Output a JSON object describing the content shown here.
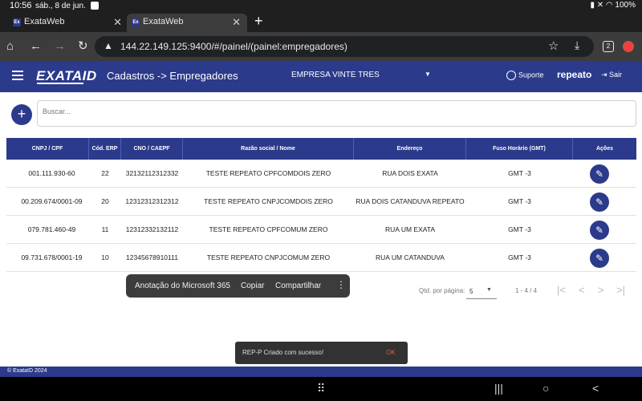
{
  "status_bar": {
    "time": "10:56",
    "date": "sáb., 8 de jun.",
    "battery": "100%"
  },
  "browser": {
    "tabs": [
      {
        "favicon": "Ex",
        "title": "ExataWeb",
        "active": false
      },
      {
        "favicon": "Ex",
        "title": "ExataWeb",
        "active": true
      }
    ],
    "url": "144.22.149.125:9400/#/painel/(painel:empregadores)",
    "tab_count": "2"
  },
  "header": {
    "logo": "EXATA",
    "logo_suffix": "ID",
    "breadcrumb": "Cadastros -> Empregadores",
    "company": "EMPRESA VINTE TRES",
    "support": "Suporte",
    "user": "repeato",
    "logout": "Sair"
  },
  "search": {
    "placeholder": "Buscar..."
  },
  "table": {
    "columns": [
      "CNPJ / CPF",
      "Cód. ERP",
      "CNO / CAEPF",
      "Razão social / Nome",
      "Endereço",
      "Fuso Horário (GMT)",
      "Ações"
    ],
    "rows": [
      {
        "doc": "001.111.930-60",
        "erp": "22",
        "cno": "32132112312332",
        "name": "TESTE REPEATO CPFCOMDOIS ZERO",
        "address": "RUA DOIS EXATA",
        "tz": "GMT -3"
      },
      {
        "doc": "00.209.674/0001-09",
        "erp": "20",
        "cno": "12312312312312",
        "name": "TESTE REPEATO CNPJCOMDOIS ZERO",
        "address": "RUA DOIS CATANDUVA REPEATO",
        "tz": "GMT -3"
      },
      {
        "doc": "079.781.460-49",
        "erp": "11",
        "cno": "12312332132112",
        "name": "TESTE REPEATO CPFCOMUM ZERO",
        "address": "RUA UM EXATA",
        "tz": "GMT -3"
      },
      {
        "doc": "09.731.678/0001-19",
        "erp": "10",
        "cno": "12345678910111",
        "name": "TESTE REPEATO CNPJCOMUM ZERO",
        "address": "RUA UM CATANDUVA",
        "tz": "GMT -3"
      }
    ]
  },
  "paginator": {
    "per_page_label": "Qtd. por página:",
    "per_page": "5",
    "range": "1 - 4 / 4"
  },
  "context_menu": {
    "items": [
      "Anotação do Microsoft 365",
      "Copiar",
      "Compartilhar"
    ]
  },
  "snackbar": {
    "message": "REP-P Criado com sucesso!",
    "action": "OK"
  },
  "footer": {
    "text": "© ExataID 2024"
  },
  "colors": {
    "primary": "#2c3a8c",
    "browser_dark": "#1f1f1f",
    "toolbar": "#3c3c3c",
    "snackbar_action": "#e05a4a"
  }
}
